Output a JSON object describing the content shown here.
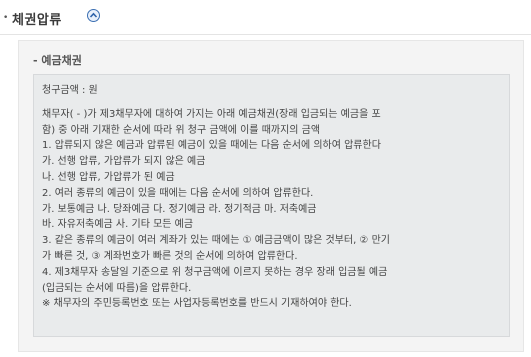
{
  "header": {
    "title": "체권압류"
  },
  "section": {
    "subtitle": "- 예금채권",
    "claim_amount": "청구금액 : 원",
    "lines": [
      "채무자( - )가 제3채무자에 대하여 가지는 아래 예금채권(장래 입금되는 예금을 포",
      "함) 중 아래 기재한 순서에 따라 위 청구 금액에 이를 때까지의 금액",
      "1. 압류되지 않은 예금과 압류된 예금이 있을 때에는 다음 순서에 의하여 압류한다",
      "가. 선행 압류, 가압류가 되지 않은 예금",
      "나. 선행 압류, 가압류가 된 예금",
      "2. 여러 종류의 예금이 있을 때에는 다음 순서에 의하여 압류한다.",
      "가. 보통예금 나. 당좌예금 다. 정기예금 라. 정기적금 마. 저축예금",
      "바. 자유저축예금 사. 기타 모든 예금",
      "3. 같은 종류의 예금이 여러 계좌가 있는 때에는 ① 예금금액이 많은 것부터, ② 만기",
      "가 빠른 것, ③ 계좌번호가 빠른 것의 순서에 의하여 압류한다.",
      "4. 제3채무자 송달일 기준으로 위 청구금액에 이르지 못하는 경우 장래 입금될 예금",
      "(입금되는 순서에 따름)을 압류한다.",
      "※ 채무자의 주민등록번호 또는 사업자등록번호를 반드시 기재하여야 한다."
    ]
  }
}
